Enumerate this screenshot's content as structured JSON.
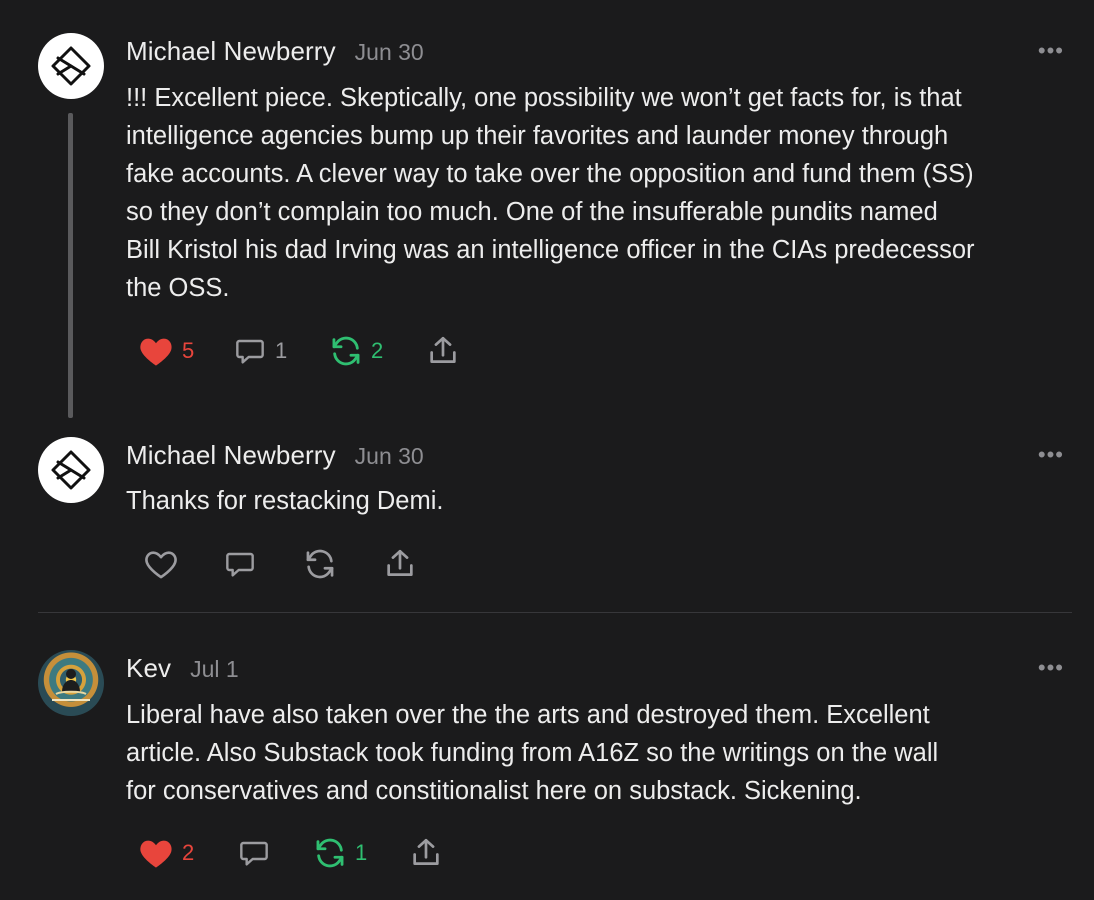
{
  "colors": {
    "background": "#1b1b1c",
    "text": "#ededed",
    "muted": "#8e8e92",
    "like": "#e8453c",
    "restack": "#2fbf71"
  },
  "comments": [
    {
      "author": "Michael Newberry",
      "date": "Jun 30",
      "more_icon": "ellipsis-icon",
      "lines": [
        "!!! Excellent piece. Skeptically, one possibility we won’t get facts for, is that",
        "intelligence agencies bump up their favorites and launder money through",
        "fake accounts. A clever way to take over the opposition and fund them (SS)",
        "so they don’t complain too much. One of the insufferable pundits named",
        "Bill Kristol his dad Irving was an intelligence officer in the CIAs predecessor",
        "the OSS."
      ],
      "likes": "5",
      "replies": "1",
      "restacks": "2",
      "liked": true,
      "restacked": true
    },
    {
      "author": "Michael Newberry",
      "date": "Jun 30",
      "more_icon": "ellipsis-icon",
      "lines": [
        "Thanks for restacking Demi."
      ],
      "liked": false,
      "restacked": false
    },
    {
      "author": "Kev",
      "date": "Jul 1",
      "more_icon": "ellipsis-icon",
      "lines": [
        "Liberal have also taken over the the arts and destroyed them. Excellent",
        "article. Also Substack took funding from A16Z so the writings on the wall",
        "for conservatives and constitionalist here on substack. Sickening."
      ],
      "likes": "2",
      "restacks": "1",
      "liked": true,
      "restacked": true
    }
  ],
  "more_label": "•••"
}
